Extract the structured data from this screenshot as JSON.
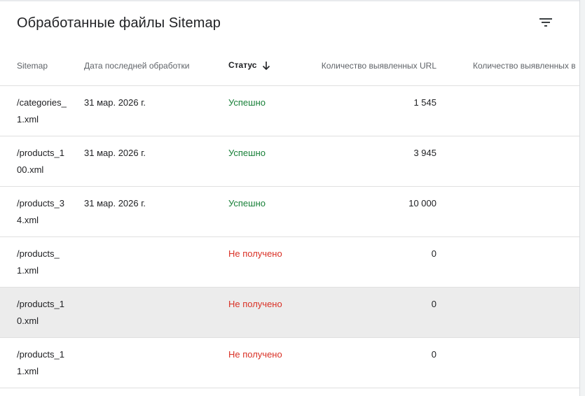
{
  "panel": {
    "title": "Обработанные файлы Sitemap"
  },
  "table": {
    "columns": {
      "sitemap": "Sitemap",
      "last_processed": "Дата последней обработки",
      "status": "Статус",
      "discovered_urls": "Количество выявленных URL",
      "discovered_video": "Количество выявленных в"
    },
    "sort": {
      "column": "status",
      "direction": "descending"
    },
    "rows": [
      {
        "sitemap_line1": "/categories_",
        "sitemap_line2": "1.xml",
        "date": "31 мар. 2026 г.",
        "status": "Успешно",
        "urls": "1 545"
      },
      {
        "sitemap_line1": "/products_1",
        "sitemap_line2": "00.xml",
        "date": "31 мар. 2026 г.",
        "status": "Успешно",
        "urls": "3 945"
      },
      {
        "sitemap_line1": "/products_3",
        "sitemap_line2": "4.xml",
        "date": "31 мар. 2026 г.",
        "status": "Успешно",
        "urls": "10 000"
      },
      {
        "sitemap_line1": "/products_",
        "sitemap_line2": "1.xml",
        "date": "",
        "status": "Не получено",
        "urls": "0"
      },
      {
        "sitemap_line1": "/products_1",
        "sitemap_line2": "0.xml",
        "date": "",
        "status": "Не получено",
        "urls": "0"
      },
      {
        "sitemap_line1": "/products_1",
        "sitemap_line2": "1.xml",
        "date": "",
        "status": "Не получено",
        "urls": "0"
      }
    ]
  },
  "colors": {
    "success": "#188038",
    "error": "#d93025",
    "hover_row": "#ececec"
  },
  "icons": {
    "filter": "filter-list-icon",
    "sort": "arrow-downward-icon"
  }
}
